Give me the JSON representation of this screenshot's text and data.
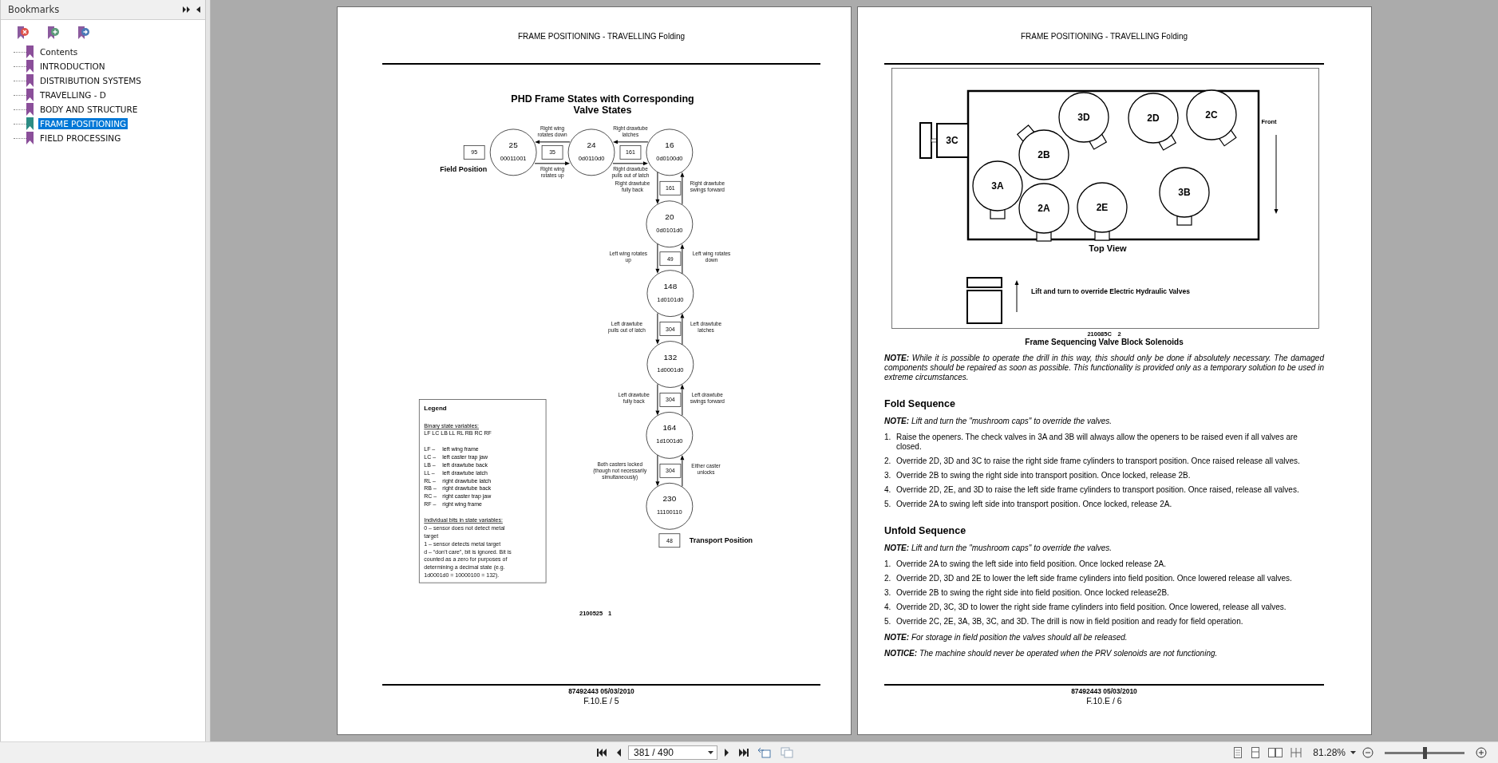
{
  "sidebar": {
    "title": "Bookmarks",
    "items": [
      {
        "label": "Contents",
        "selected": false
      },
      {
        "label": "INTRODUCTION",
        "selected": false
      },
      {
        "label": "DISTRIBUTION SYSTEMS",
        "selected": false
      },
      {
        "label": "TRAVELLING - D",
        "selected": false
      },
      {
        "label": "BODY AND STRUCTURE",
        "selected": false
      },
      {
        "label": "FRAME POSITIONING",
        "selected": true
      },
      {
        "label": "FIELD PROCESSING",
        "selected": false
      }
    ]
  },
  "pages": [
    {
      "kind": "state_diagram",
      "header": "FRAME POSITIONING - TRAVELLING Folding",
      "title": [
        "PHD Frame States with Corresponding",
        "Valve States"
      ],
      "states": [
        {
          "number": "25",
          "code": "00011001"
        },
        {
          "number": "24",
          "code": "0d0110d0"
        },
        {
          "number": "16",
          "code": "0d0100d0"
        },
        {
          "number": "20",
          "code": "0d0101d0"
        },
        {
          "number": "148",
          "code": "1d0101d0"
        },
        {
          "number": "132",
          "code": "1d0001d0"
        },
        {
          "number": "164",
          "code": "1d1001d0"
        },
        {
          "number": "230",
          "code": "11100110"
        }
      ],
      "transitions": [
        {
          "valve": "35",
          "toward_field": [
            "Right wing",
            "rotates down"
          ],
          "toward_transport": [
            "Right wing",
            "rotates up"
          ]
        },
        {
          "valve": "161",
          "toward_field": [
            "Right drawtube",
            "latches"
          ],
          "toward_transport": [
            "Right drawtube",
            "pulls out of latch"
          ]
        },
        {
          "valve": "161",
          "toward_field": [
            "Right drawtube",
            "swings forward"
          ],
          "toward_transport": [
            "Right drawtube",
            "fully back"
          ]
        },
        {
          "valve": "49",
          "toward_field": [
            "Left wing rotates",
            "down"
          ],
          "toward_transport": [
            "Left wing rotates",
            "up"
          ]
        },
        {
          "valve": "304",
          "toward_field": [
            "Left drawtube",
            "latches"
          ],
          "toward_transport": [
            "Left drawtube",
            "pulls out of latch"
          ]
        },
        {
          "valve": "304",
          "toward_field": [
            "Left drawtube",
            "swings forward"
          ],
          "toward_transport": [
            "Left drawtube",
            "fully back"
          ]
        },
        {
          "valve": "304",
          "toward_field": [
            "Either caster",
            "unlocks"
          ],
          "toward_transport": [
            "Both casters locked",
            "(though not necessarily",
            "simultaneously)"
          ]
        }
      ],
      "field": {
        "valve": "95",
        "label": "Field Position"
      },
      "transport": {
        "valve": "48",
        "label": "Transport Position"
      },
      "legend": {
        "title": "Legend",
        "variables_heading": "Binary state variables:",
        "variables": "LF LC LB LL RL RB RC RF",
        "definitions": [
          {
            "code": "LF –",
            "meaning": "left wing frame"
          },
          {
            "code": "LC –",
            "meaning": "left caster trap jaw"
          },
          {
            "code": "LB –",
            "meaning": "left drawtube back"
          },
          {
            "code": "LL –",
            "meaning": "left drawtube latch"
          },
          {
            "code": "RL –",
            "meaning": "right drawtube latch"
          },
          {
            "code": "RB –",
            "meaning": "right drawtube back"
          },
          {
            "code": "RC –",
            "meaning": "right caster trap jaw"
          },
          {
            "code": "RF –",
            "meaning": "right wing frame"
          }
        ],
        "bits_heading": "Individual bits in state variables:",
        "bits": [
          [
            "0 – sensor does not detect metal",
            "target"
          ],
          [
            "1 – sensor detects metal target"
          ],
          [
            "d – “don’t care”, bit is ignored. Bit is",
            "counted as a zero for purposes of",
            "determining a decimal state (e.g.",
            "1d0001d0 = 10000100 = 132)."
          ]
        ]
      },
      "figure_id": "2100525",
      "figure_number": "1",
      "footer": {
        "document": "87492443 05/03/2010",
        "page": "F.10.E / 5"
      }
    },
    {
      "kind": "solenoid_figure",
      "header": "FRAME POSITIONING - TRAVELLING Folding",
      "valves": [
        {
          "label": "3D"
        },
        {
          "label": "2D"
        },
        {
          "label": "2C"
        },
        {
          "label": "2B"
        },
        {
          "label": "3A"
        },
        {
          "label": "2A"
        },
        {
          "label": "2E"
        },
        {
          "label": "3B"
        }
      ],
      "side_block": "3C",
      "front_label": "Front",
      "view_label": "Top View",
      "override_hint": "Lift and turn to override Electric Hydraulic Valves",
      "figure_id": "210085C",
      "figure_number": "2",
      "caption": "Frame Sequencing Valve Block Solenoids",
      "sections": [
        {
          "kind": "note",
          "text": "**NOTE:** While it is possible to operate the drill in this way, this should only be done if absolutely necessary.  The damaged components should be repaired as soon as possible.  This functionality is provided only as a temporary solution to be used in extreme circumstances."
        },
        {
          "kind": "heading",
          "text": "Fold Sequence"
        },
        {
          "kind": "note",
          "text": "**NOTE:** Lift and turn the \"mushroom caps\" to override the valves."
        },
        {
          "kind": "list",
          "items": [
            {
              "number": "1.",
              "text": "Raise the openers.  The check valves in 3A and 3B will always allow the openers to be raised even if all valves are closed."
            },
            {
              "number": "2.",
              "text": "Override 2D, 3D and 3C to raise the right side frame cylinders to transport position. Once raised release all valves."
            },
            {
              "number": "3.",
              "text": "Override 2B to swing the right side into transport position.  Once locked, release 2B."
            },
            {
              "number": "4.",
              "text": "Override 2D, 2E, and 3D to raise the left side frame cylinders to transport position. Once raised, release all valves."
            },
            {
              "number": "5.",
              "text": "Override 2A to swing left side into transport position.  Once locked, release 2A."
            }
          ]
        },
        {
          "kind": "heading",
          "text": "Unfold Sequence"
        },
        {
          "kind": "note",
          "text": "**NOTE:** Lift and turn the \"mushroom caps\" to override the valves."
        },
        {
          "kind": "list",
          "items": [
            {
              "number": "1.",
              "text": "Override 2A to swing the left side into field position.  Once locked release 2A."
            },
            {
              "number": "2.",
              "text": "Override 2D, 3D and 2E to lower the left side frame cylinders into field position.  Once lowered release all valves."
            },
            {
              "number": "3.",
              "text": "Override 2B to swing the right side into field position.  Once locked release2B."
            },
            {
              "number": "4.",
              "text": "Override 2D, 3C, 3D to lower the right side frame cylinders into field position.  Once lowered, release all valves."
            },
            {
              "number": "5.",
              "text": "Override 2C, 2E, 3A, 3B, 3C, and 3D. The drill is now in field position and ready for field operation."
            }
          ]
        },
        {
          "kind": "note",
          "text": "**NOTE:** For storage in field position the valves should all be released."
        },
        {
          "kind": "note",
          "text": "**NOTICE:** The machine should never be operated when the PRV solenoids are not functioning."
        }
      ],
      "footer": {
        "document": "87492443 05/03/2010",
        "page": "F.10.E / 6"
      }
    }
  ],
  "toolbar": {
    "page_field": "381 / 490",
    "zoom": "81.28%",
    "zoom_slider": {
      "level": 0.5
    }
  }
}
